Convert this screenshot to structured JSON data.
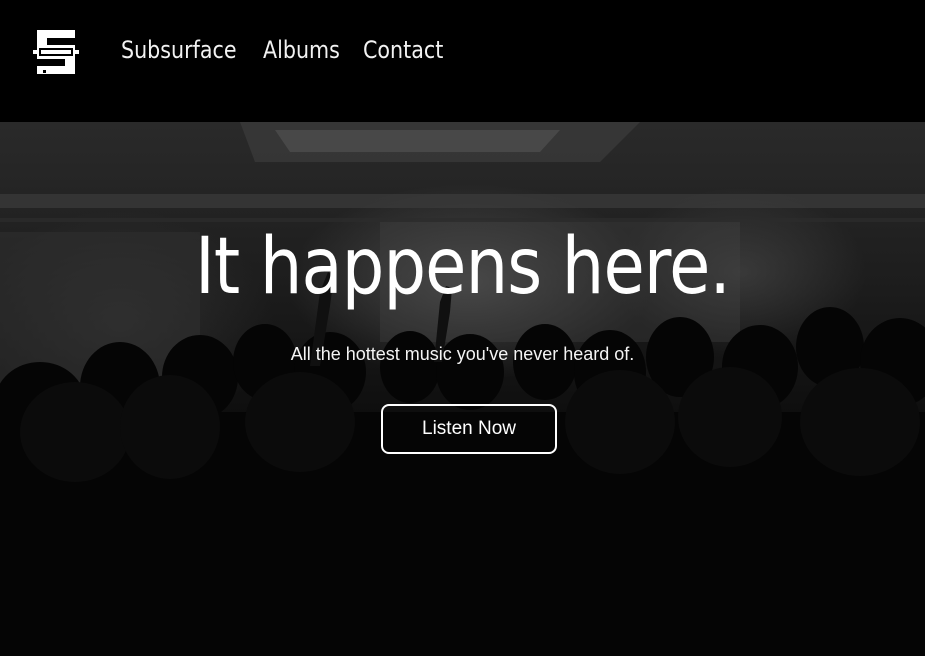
{
  "header": {
    "logo_icon": "subsurface-s-logo-icon",
    "nav": [
      {
        "label": "Subsurface"
      },
      {
        "label": "Albums"
      },
      {
        "label": "Contact"
      }
    ]
  },
  "hero": {
    "background": "concert-crowd-photo",
    "title": "It happens here.",
    "subtitle": "All the hottest music you've never heard of.",
    "cta_label": "Listen Now"
  },
  "colors": {
    "background": "#000000",
    "text": "#ffffff",
    "button_border": "#ffffff"
  }
}
